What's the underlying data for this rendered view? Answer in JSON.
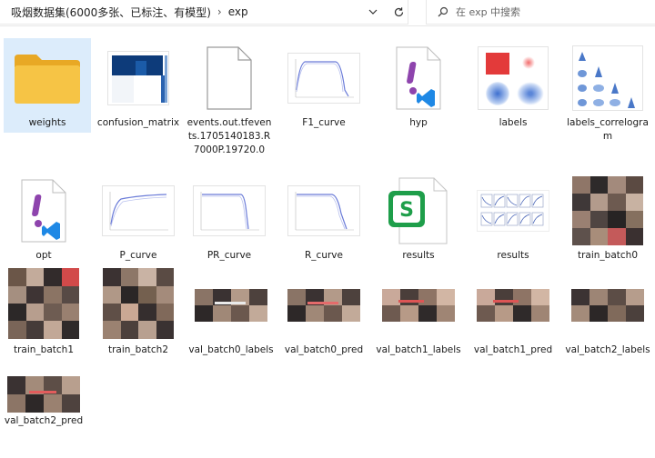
{
  "breadcrumb": {
    "folder": "吸烟数据集(6000多张、已标注、有模型)",
    "current": "exp"
  },
  "search": {
    "placeholder": "在 exp 中搜索"
  },
  "files": [
    {
      "name": "weights",
      "icon": "folder-icon"
    },
    {
      "name": "confusion_matrix",
      "icon": "image-thumbnail"
    },
    {
      "name": "events.out.tfevents.1705140183.R7000P.19720.0",
      "icon": "document-icon"
    },
    {
      "name": "F1_curve",
      "icon": "image-thumbnail"
    },
    {
      "name": "hyp",
      "icon": "yaml-file-icon"
    },
    {
      "name": "labels",
      "icon": "image-thumbnail"
    },
    {
      "name": "labels_correlogram",
      "icon": "image-thumbnail"
    },
    {
      "name": "opt",
      "icon": "yaml-file-icon"
    },
    {
      "name": "P_curve",
      "icon": "image-thumbnail"
    },
    {
      "name": "PR_curve",
      "icon": "image-thumbnail"
    },
    {
      "name": "R_curve",
      "icon": "image-thumbnail"
    },
    {
      "name": "results",
      "icon": "spreadsheet-icon"
    },
    {
      "name": "results",
      "icon": "image-thumbnail"
    },
    {
      "name": "train_batch0",
      "icon": "image-thumbnail"
    },
    {
      "name": "train_batch1",
      "icon": "image-thumbnail"
    },
    {
      "name": "train_batch2",
      "icon": "image-thumbnail"
    },
    {
      "name": "val_batch0_labels",
      "icon": "image-thumbnail"
    },
    {
      "name": "val_batch0_pred",
      "icon": "image-thumbnail"
    },
    {
      "name": "val_batch1_labels",
      "icon": "image-thumbnail"
    },
    {
      "name": "val_batch1_pred",
      "icon": "image-thumbnail"
    },
    {
      "name": "val_batch2_labels",
      "icon": "image-thumbnail"
    },
    {
      "name": "val_batch2_pred",
      "icon": "image-thumbnail"
    }
  ],
  "colors": {
    "selection": "#dcecfb",
    "folder": "#f6c445",
    "accent_blue": "#1565c0",
    "spreadsheet_green": "#1e9e4a",
    "yaml_purple": "#8e44ad"
  }
}
